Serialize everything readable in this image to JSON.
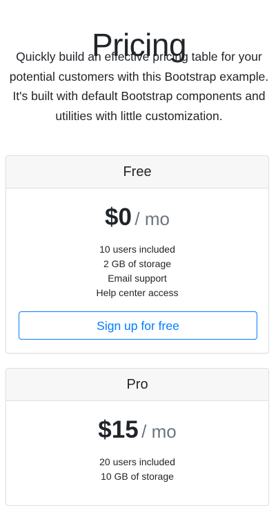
{
  "page": {
    "title": "Pricing",
    "lead": "Quickly build an effective pricing table for your potential customers with this Bootstrap example. It's built with default Bootstrap components and utilities with little customization."
  },
  "plans": [
    {
      "name": "Free",
      "price": "$0",
      "period": "/ mo",
      "features": [
        "10 users included",
        "2 GB of storage",
        "Email support",
        "Help center access"
      ],
      "button_label": "Sign up for free"
    },
    {
      "name": "Pro",
      "price": "$15",
      "period": "/ mo",
      "features": [
        "20 users included",
        "10 GB of storage"
      ]
    }
  ],
  "colors": {
    "accent": "#007bff",
    "header_bg": "#f7f7f7",
    "muted": "#6c757d",
    "text": "#212529"
  }
}
